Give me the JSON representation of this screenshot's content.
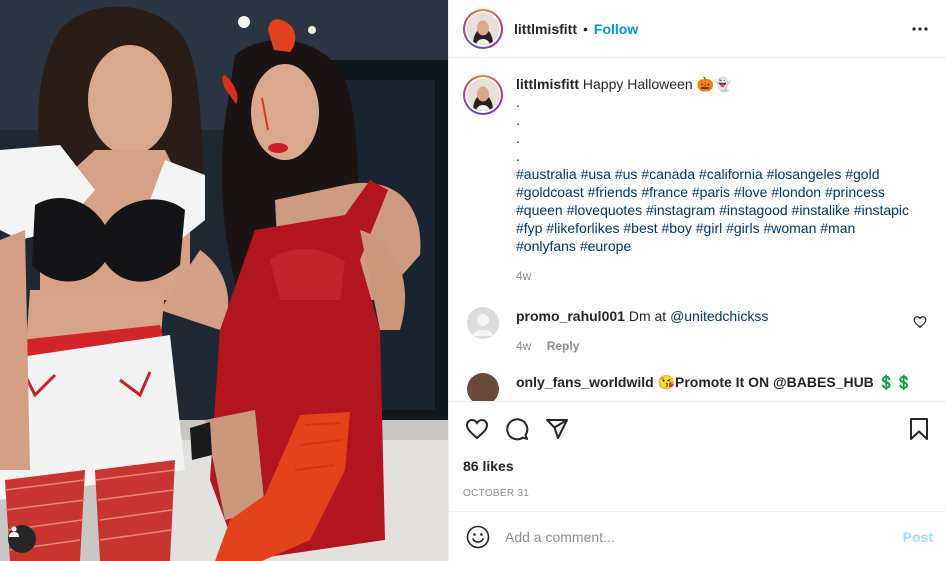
{
  "header": {
    "username": "littlmisfitt",
    "separator": "•",
    "follow_label": "Follow"
  },
  "caption": {
    "username": "littlmisfitt",
    "text": "Happy Halloween 🎃👻",
    "dots": [
      ".",
      ".",
      ".",
      "."
    ],
    "hashtags": "#australia #usa #us #canada #california #losangeles #gold #goldcoast #friends #france #paris #love #london #princess #queen #lovequotes #instagram #instagood #instalike #instapic #fyp #likeforlikes #best #boy #girl #girls #woman #man #onlyfans #europe",
    "age": "4w"
  },
  "comments": [
    {
      "username": "promo_rahul001",
      "text": "Dm at",
      "mention": "@unitedchickss",
      "age": "4w",
      "reply_label": "Reply"
    }
  ],
  "peek_comment": {
    "text": "only_fans_worldwild 😘Promote It ON @BABES_HUB 💲💲"
  },
  "actions": {
    "likes": "86 likes",
    "date": "OCTOBER 31"
  },
  "add_comment": {
    "placeholder": "Add a comment...",
    "post_label": "Post"
  },
  "icons": {
    "more": "more-horizontal-icon",
    "like": "heart-icon",
    "comment": "comment-bubble-icon",
    "share": "paper-plane-icon",
    "save": "bookmark-icon",
    "emoji": "smiley-icon",
    "tag": "person-tag-icon"
  },
  "colors": {
    "accent": "#0095f6",
    "link": "#00376b",
    "muted": "#8e8e8e",
    "text": "#262626"
  }
}
